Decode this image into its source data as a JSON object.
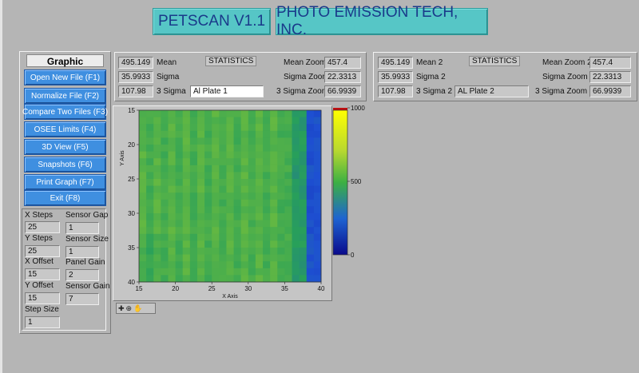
{
  "header": {
    "app_title": "PETSCAN V1.1",
    "company": "PHOTO EMISSION TECH, INC."
  },
  "graphic_displays": {
    "title": "Graphic Displays",
    "buttons": [
      "Open New File (F1)",
      "Normalize File (F2)",
      "Compare Two Files (F3)",
      "OSEE Limits (F4)",
      "3D View (F5)",
      "Snapshots (F6)",
      "Print Graph (F7)",
      "Exit (F8)"
    ]
  },
  "params": {
    "x_steps_label": "X Steps",
    "x_steps": "25",
    "y_steps_label": "Y Steps",
    "y_steps": "25",
    "x_offset_label": "X Offset",
    "x_offset": "15",
    "y_offset_label": "Y Offset",
    "y_offset": "15",
    "step_size_label": "Step Size",
    "step_size": "1",
    "sensor_gap_label": "Sensor Gap",
    "sensor_gap": "1",
    "sensor_size_label": "Sensor Size",
    "sensor_size": "1",
    "panel_gain_label": "Panel Gain",
    "panel_gain": "2",
    "sensor_gain_label": "Sensor Gain",
    "sensor_gain": "7"
  },
  "stats1": {
    "header": "STATISTICS",
    "mean": "495.149",
    "mean_label": "Mean",
    "sigma": "35.9933",
    "sigma_label": "Sigma",
    "three_sigma": "107.98",
    "three_sigma_label": "3 Sigma",
    "plate_name": "Al Plate 1",
    "mean_zoom_label": "Mean Zoom",
    "mean_zoom": "457.4",
    "sigma_zoom_label": "Sigma Zoom",
    "sigma_zoom": "22.3313",
    "three_sigma_zoom_label": "3 Sigma Zoom",
    "three_sigma_zoom": "66.9939"
  },
  "stats2": {
    "header": "STATISTICS",
    "mean": "495.149",
    "mean_label": "Mean 2",
    "sigma": "35.9933",
    "sigma_label": "Sigma 2",
    "three_sigma": "107.98",
    "three_sigma_label": "3 Sigma 2",
    "plate_name": "AL Plate 2",
    "mean_zoom_label": "Mean Zoom 2",
    "mean_zoom": "457.4",
    "sigma_zoom_label": "Sigma Zoom 2",
    "sigma_zoom": "22.3313",
    "three_sigma_zoom_label": "3 Sigma Zoom 2",
    "three_sigma_zoom": "66.9939"
  },
  "chart_data": {
    "type": "heatmap",
    "xlabel": "X Axis",
    "ylabel": "Y Axis",
    "xlim": [
      15,
      40
    ],
    "ylim": [
      15,
      40
    ],
    "x_ticks": [
      "15",
      "20",
      "25",
      "30",
      "35",
      "40"
    ],
    "y_ticks": [
      "15",
      "20",
      "25",
      "30",
      "35",
      "40"
    ],
    "colorbar_ticks": [
      "1000",
      "500",
      "0"
    ],
    "zlim": [
      0,
      1000
    ],
    "colors": {
      "high": "#ffff00",
      "mid": "#3cb043",
      "low": "#0000a0"
    }
  }
}
